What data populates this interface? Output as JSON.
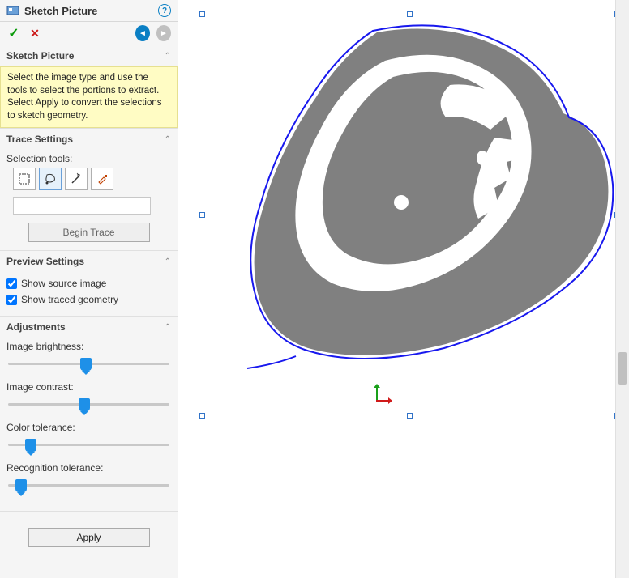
{
  "header": {
    "title": "Sketch Picture"
  },
  "sections": {
    "sketch_picture": {
      "title": "Sketch Picture",
      "hint": "Select the image type and use the tools to select the portions to extract. Select Apply to convert the selections to sketch geometry."
    },
    "trace_settings": {
      "title": "Trace Settings",
      "selection_tools_label": "Selection tools:",
      "begin_trace_label": "Begin Trace"
    },
    "preview_settings": {
      "title": "Preview Settings",
      "show_source_label": "Show source image",
      "show_source_checked": true,
      "show_traced_label": "Show traced geometry",
      "show_traced_checked": true
    },
    "adjustments": {
      "title": "Adjustments",
      "brightness_label": "Image brightness:",
      "brightness_value": 48,
      "contrast_label": "Image contrast:",
      "contrast_value": 47,
      "color_tol_label": "Color tolerance:",
      "color_tol_value": 14,
      "recog_tol_label": "Recognition tolerance:",
      "recog_tol_value": 8
    }
  },
  "apply_label": "Apply"
}
